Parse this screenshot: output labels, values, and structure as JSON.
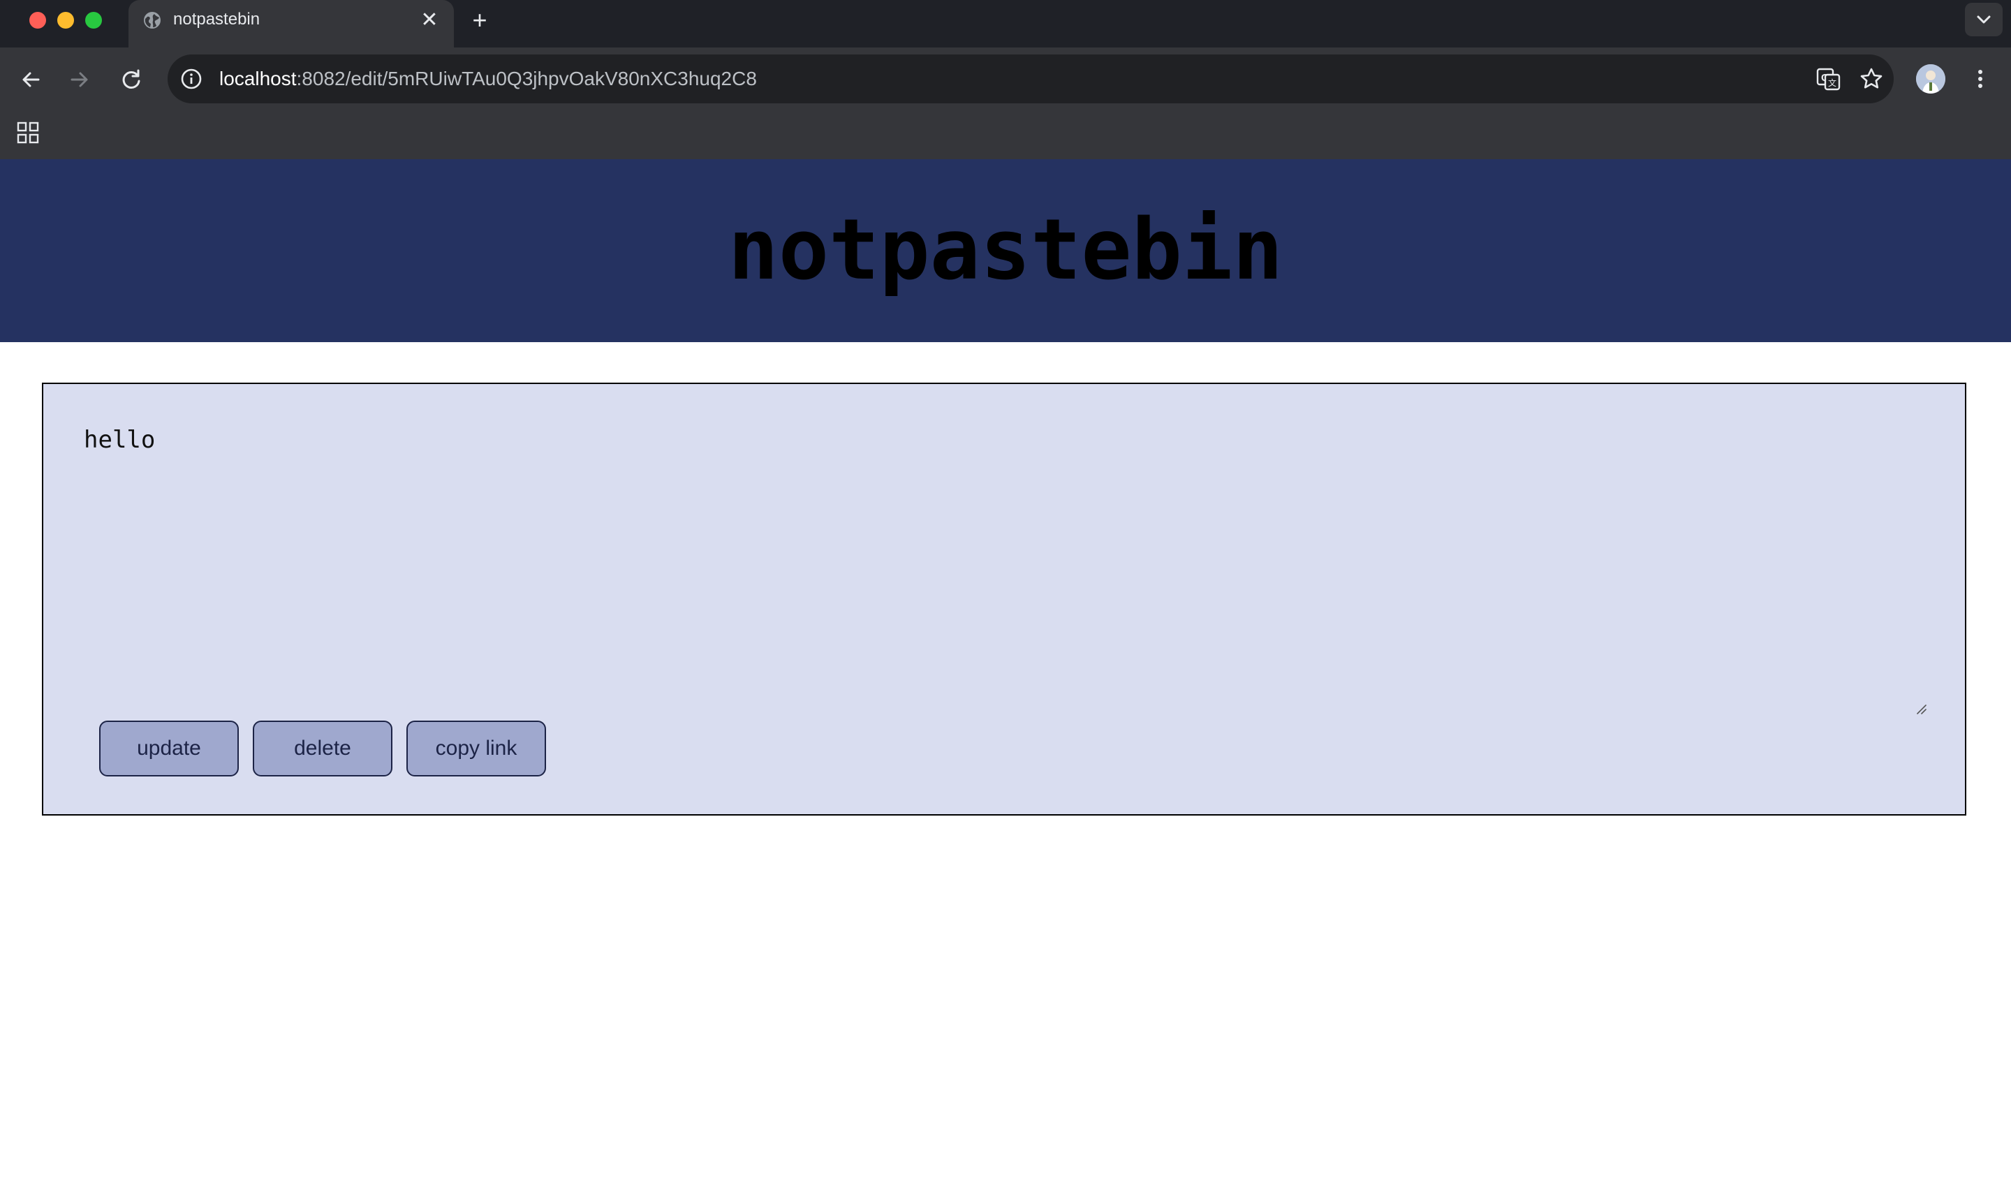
{
  "browser": {
    "tab_title": "notpastebin",
    "tab_close_glyph": "✕",
    "new_tab_glyph": "+",
    "url_host": "localhost",
    "url_rest": ":8082/edit/5mRUiwTAu0Q3jhpvOakV80nXC3huq2C8"
  },
  "icons": {
    "favicon": "globe-icon",
    "back": "arrow-left-icon",
    "forward": "arrow-right-icon",
    "reload": "reload-icon",
    "site_info": "info-icon",
    "translate": "translate-icon",
    "bookmark": "star-icon",
    "profile": "avatar",
    "menu": "kebab-menu-icon",
    "apps": "apps-grid-icon",
    "tab_search": "chevron-down-icon"
  },
  "colors": {
    "header_bg": "#253261",
    "panel_bg": "#d9ddf0",
    "button_bg": "#9fa8ce",
    "button_text": "#1c2346"
  },
  "page": {
    "title": "notpastebin",
    "paste_content": "hello",
    "buttons": {
      "update": "update",
      "delete": "delete",
      "copy_link": "copy link"
    }
  }
}
